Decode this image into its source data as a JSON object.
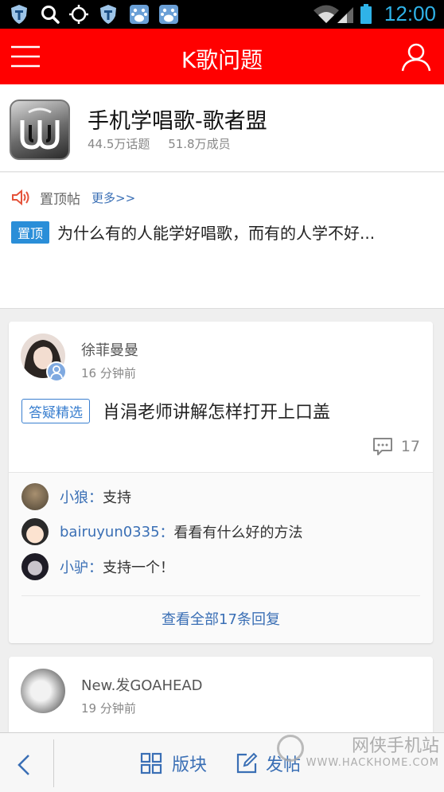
{
  "status_bar": {
    "time": "12:00",
    "icons": [
      "shield-icon",
      "search-icon",
      "crosshair-icon",
      "shield-icon",
      "baidu-icon",
      "baidu-icon",
      "wifi-icon",
      "signal-icon",
      "battery-icon"
    ]
  },
  "app_bar": {
    "title": "K歌问题",
    "menu_icon": "menu-icon",
    "user_icon": "user-icon",
    "accent_color": "#ff0000"
  },
  "group": {
    "name": "手机学唱歌-歌者盟",
    "topics": "44.5万话题",
    "members": "51.8万成员"
  },
  "pinned": {
    "label": "置顶帖",
    "more": "更多>>",
    "tag": "置顶",
    "title": "为什么有的人能学好唱歌，而有的人学不好..."
  },
  "posts": [
    {
      "author": "徐菲曼曼",
      "time": "16 分钟前",
      "tag": "答疑精选",
      "title": "肖涓老师讲解怎样打开上口盖",
      "comments": "17",
      "replies": [
        {
          "name": "小狼",
          "sep": "：",
          "text": "支持"
        },
        {
          "name": "bairuyun0335",
          "sep": "：",
          "text": "看看有什么好的方法"
        },
        {
          "name": "小驴",
          "sep": "：",
          "text": "支持一个！"
        }
      ],
      "view_all": "查看全部17条回复"
    },
    {
      "author": "New.发GOAHEAD",
      "time": "19 分钟前"
    }
  ],
  "bottom_bar": {
    "sections": "版块",
    "post": "发帖"
  },
  "watermark": {
    "text": "网侠手机站",
    "url": "WWW.HACKHOME.COM"
  }
}
